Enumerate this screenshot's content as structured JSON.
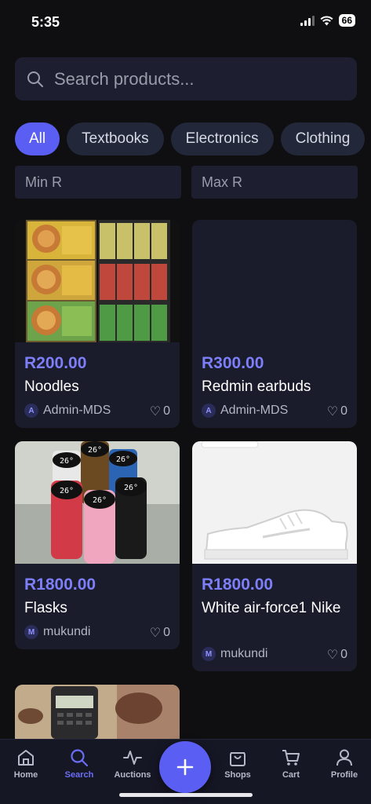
{
  "status": {
    "time": "5:35",
    "battery": "66"
  },
  "search": {
    "placeholder": "Search products..."
  },
  "categories": [
    "All",
    "Textbooks",
    "Electronics",
    "Clothing"
  ],
  "price_filter": {
    "min_placeholder": "Min R",
    "max_placeholder": "Max R"
  },
  "products": [
    {
      "price": "R200.00",
      "title": "Noodles",
      "seller": "Admin-MDS",
      "avatar": "A",
      "likes": "0"
    },
    {
      "price": "R300.00",
      "title": "Redmin earbuds",
      "seller": "Admin-MDS",
      "avatar": "A",
      "likes": "0"
    },
    {
      "price": "R1800.00",
      "title": "Flasks",
      "seller": "mukundi",
      "avatar": "M",
      "likes": "0"
    },
    {
      "price": "R1800.00",
      "title": "White air-force1 Nike",
      "seller": "mukundi",
      "avatar": "M",
      "likes": "0"
    }
  ],
  "flask_display": "26°",
  "nav": {
    "home": "Home",
    "search": "Search",
    "auctions": "Auctions",
    "shops": "Shops",
    "cart": "Cart",
    "profile": "Profile"
  },
  "colors": {
    "accent": "#5b5ef2",
    "background": "#0f0f12",
    "card": "#1a1b2b"
  }
}
